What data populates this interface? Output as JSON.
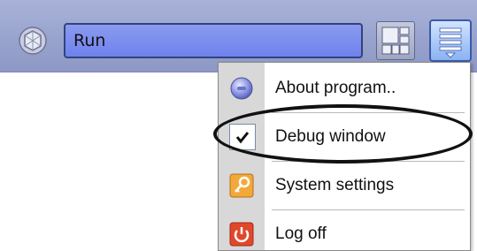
{
  "toolbar": {
    "run_field_value": "Run",
    "app_icon": "camera-lens-icon",
    "grid_icon": "grid-layout-icon",
    "menu_icon": "menu-list-icon"
  },
  "menu": {
    "items": [
      {
        "label": "About program..",
        "icon": "info-orb-icon"
      },
      {
        "label": "Debug window",
        "icon": "checkbox-checked-icon",
        "checked": true
      },
      {
        "label": "System settings",
        "icon": "key-icon"
      },
      {
        "label": "Log off",
        "icon": "power-icon"
      }
    ]
  },
  "colors": {
    "toolbar": "#98a3cd",
    "run_field": "#7b8cee",
    "menu_gutter": "#d8d8d8"
  }
}
